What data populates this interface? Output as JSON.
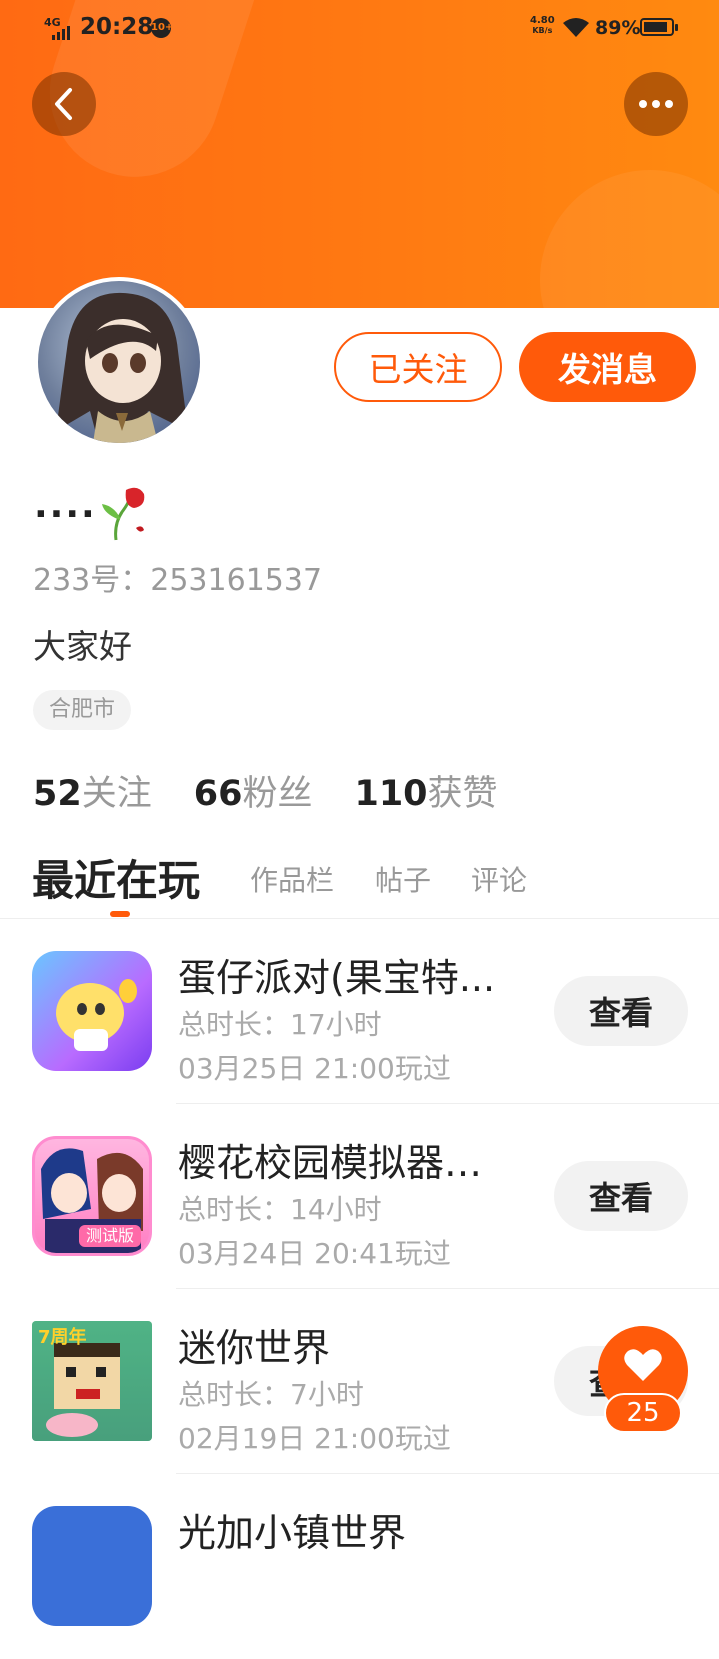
{
  "status_bar": {
    "network": "4G",
    "time": "20:28",
    "notification_badge": "10+",
    "speed_value": "4.80",
    "speed_unit": "KB/s",
    "battery_percent": "89%",
    "battery_level": 0.89
  },
  "header": {
    "back_icon": "chevron-left-icon",
    "more_icon": "more-dots-icon",
    "color": "#ff7a12"
  },
  "profile": {
    "follow_button": "已关注",
    "message_button": "发消息",
    "nickname": "....",
    "nickname_emoji": "wilted-rose-icon",
    "user_id": "233号：253161537",
    "bio": "大家好",
    "location": "合肥市",
    "accent_color": "#ff5a0a"
  },
  "stats": {
    "following_count": "52",
    "following_label": "关注",
    "fans_count": "66",
    "fans_label": "粉丝",
    "likes_count": "110",
    "likes_label": "获赞"
  },
  "tabs": {
    "active": "最近在玩",
    "items": [
      "作品栏",
      "帖子",
      "评论"
    ]
  },
  "games": [
    {
      "name": "蛋仔派对(果宝特...",
      "duration": "总时长：17小时",
      "last_played": "03月25日 21:00玩过",
      "button": "查看"
    },
    {
      "name": "樱花校园模拟器测...",
      "duration": "总时长：14小时",
      "last_played": "03月24日 20:41玩过",
      "button": "查看"
    },
    {
      "name": "迷你世界",
      "duration": "总时长：7小时",
      "last_played": "02月19日 21:00玩过",
      "button": "查看"
    },
    {
      "name": "光加小镇世界"
    }
  ],
  "game_icon_texts": {
    "game2_badge": "测试版",
    "game3_badge": "7周年"
  },
  "like_fab": {
    "icon": "heart-icon",
    "count": "25"
  }
}
